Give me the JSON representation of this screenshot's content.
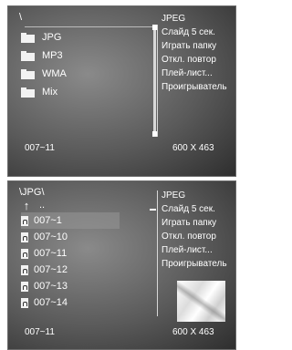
{
  "screen1": {
    "path": "\\",
    "items": [
      "JPG",
      "MP3",
      "WMA",
      "Mix"
    ],
    "menu": [
      "JPEG",
      "Слайд 5 сек.",
      "Играть папку",
      "Откл. повтор",
      "Плей-лист...",
      "Проигрыватель"
    ],
    "footer_left": "007~11",
    "footer_right": "600 X 463"
  },
  "screen2": {
    "path": "\\JPG\\",
    "up_item": "..",
    "items": [
      "007~1",
      "007~10",
      "007~11",
      "007~12",
      "007~13",
      "007~14"
    ],
    "selected_index": 0,
    "menu": [
      "JPEG",
      "Слайд 5 сек.",
      "Играть папку",
      "Откл. повтор",
      "Плей-лист...",
      "Проигрыватель"
    ],
    "footer_left": "007~11",
    "footer_right": "600 X 463"
  },
  "icons": {
    "folder": "folder-icon",
    "file": "file-icon",
    "up": "up-arrow-icon",
    "marker": "menu-marker-icon"
  },
  "colors": {
    "text": "#ffffff",
    "background": "#5a5a5a"
  }
}
